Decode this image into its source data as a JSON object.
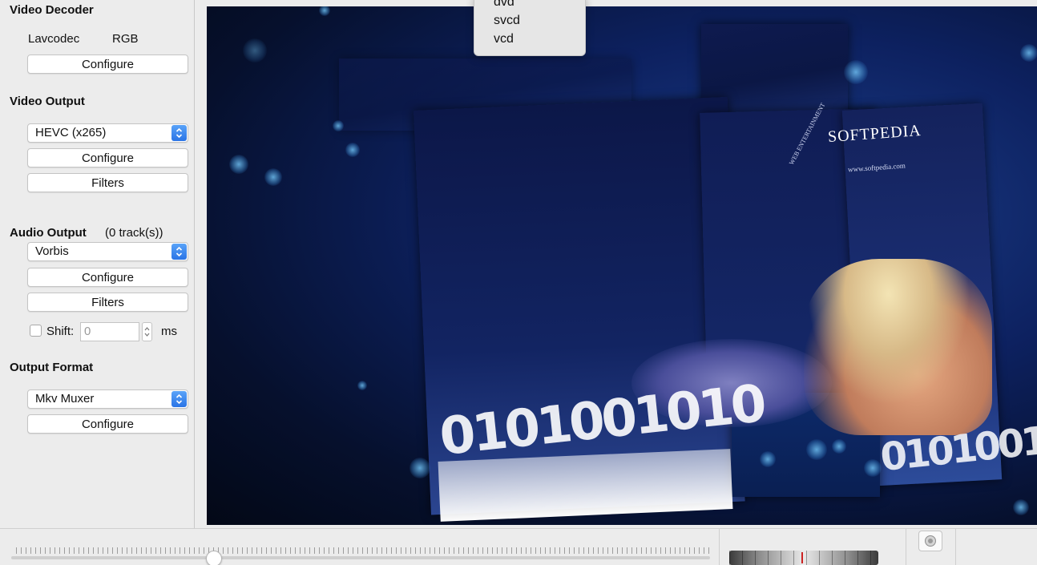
{
  "sidebar": {
    "video_decoder": {
      "title": "Video Decoder",
      "decoder_name": "Lavcodec",
      "color_space": "RGB",
      "configure_label": "Configure"
    },
    "video_output": {
      "title": "Video Output",
      "codec_selected": "HEVC (x265)",
      "configure_label": "Configure",
      "filters_label": "Filters"
    },
    "audio_output": {
      "title": "Audio Output",
      "track_count": "(0 track(s))",
      "codec_selected": "Vorbis",
      "configure_label": "Configure",
      "filters_label": "Filters",
      "shift_label": "Shift:",
      "shift_value": "0",
      "shift_unit": "ms",
      "shift_checked": false
    },
    "output_format": {
      "title": "Output Format",
      "muxer_selected": "Mkv Muxer",
      "configure_label": "Configure"
    }
  },
  "dropdown_menu": {
    "options": [
      "dvd",
      "svcd",
      "vcd"
    ]
  },
  "video_preview": {
    "brand_text": "SOFTPEDIA",
    "brand_url": "www.softpedia.com",
    "side_text": "WEB ENTERTAINMENT",
    "digits": "0101001010"
  },
  "timeline": {
    "position_fraction": 0.29
  },
  "colors": {
    "accent": "#2f7bea",
    "video_bg": "#0d2160"
  }
}
